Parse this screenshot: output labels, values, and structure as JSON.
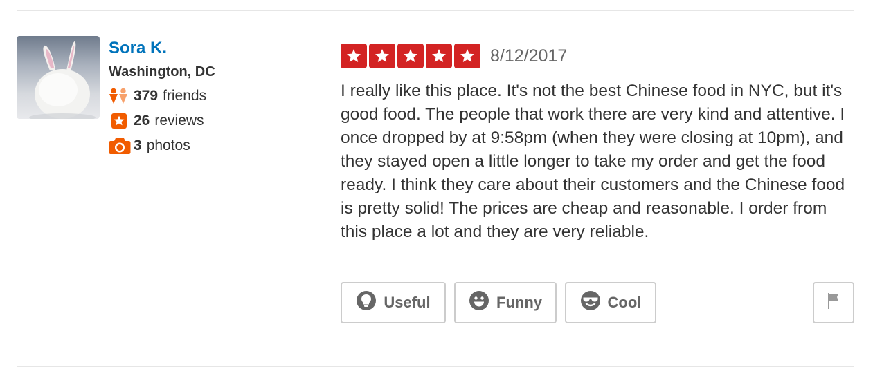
{
  "user": {
    "name": "Sora K.",
    "location": "Washington, DC",
    "friends_count": "379",
    "friends_label": "friends",
    "reviews_count": "26",
    "reviews_label": "reviews",
    "photos_count": "3",
    "photos_label": "photos"
  },
  "review": {
    "rating": 5,
    "rating_max": 5,
    "date": "8/12/2017",
    "text": "I really like this place.  It's not the best Chinese food in NYC, but it's good food.  The people that work there are very kind and attentive.  I once dropped by at 9:58pm (when they were closing at 10pm), and they stayed open a little longer to take my order and get the food ready.  I think they care about their customers and the Chinese food is pretty solid!  The prices are cheap and reasonable.  I order from this place a lot and they are very reliable."
  },
  "votes": {
    "useful_label": "Useful",
    "funny_label": "Funny",
    "cool_label": "Cool"
  },
  "icons": {
    "friends": "friends-icon",
    "reviews": "star-review-icon",
    "photos": "camera-icon",
    "useful": "lightbulb-icon",
    "funny": "smiley-icon",
    "cool": "sunglasses-icon",
    "flag": "flag-icon"
  },
  "colors": {
    "name_link": "#0073bb",
    "star_red": "#d32323",
    "stat_orange": "#f15c00",
    "text": "#333333",
    "muted": "#666666",
    "border": "#cccccc"
  }
}
